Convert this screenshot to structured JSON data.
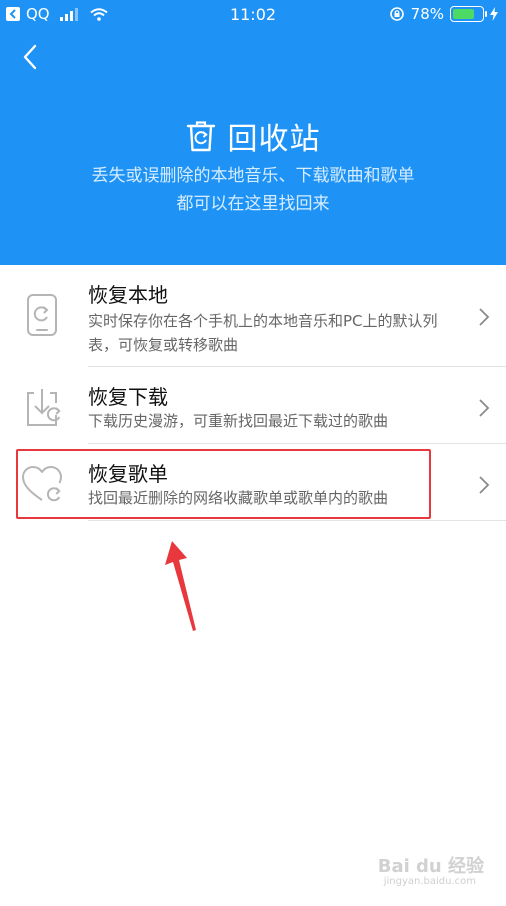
{
  "status_bar": {
    "carrier": "QQ",
    "time": "11:02",
    "battery": "78%",
    "battery_level": 0.78,
    "icons": [
      "back-to-app-icon",
      "signal-icon",
      "wifi-icon",
      "rotation-lock-icon",
      "battery-icon",
      "charging-icon"
    ]
  },
  "header": {
    "title": "回收站",
    "subtitle_line1": "丢失或误删除的本地音乐、下载歌曲和歌单",
    "subtitle_line2": "都可以在这里找回来",
    "background_color": "#1e93f5",
    "icons": [
      "back-icon",
      "trash-restore-icon"
    ]
  },
  "items": [
    {
      "title": "恢复本地",
      "desc_line1": "实时保存你在各个手机上的本地音乐和PC上的默认列",
      "desc_line2": "表，可恢复或转移歌曲",
      "icon": "phone-restore-icon"
    },
    {
      "title": "恢复下载",
      "desc_line1": "下载历史漫游，可重新找回最近下载过的歌曲",
      "icon": "download-restore-icon"
    },
    {
      "title": "恢复歌单",
      "desc_line1": "找回最近删除的网络收藏歌单或歌单内的歌曲",
      "icon": "heart-restore-icon"
    }
  ],
  "annotation": {
    "highlight_color": "#e8383d"
  },
  "watermark": {
    "text": "Bai du 经验",
    "sub": "jingyan.baidu.com"
  }
}
